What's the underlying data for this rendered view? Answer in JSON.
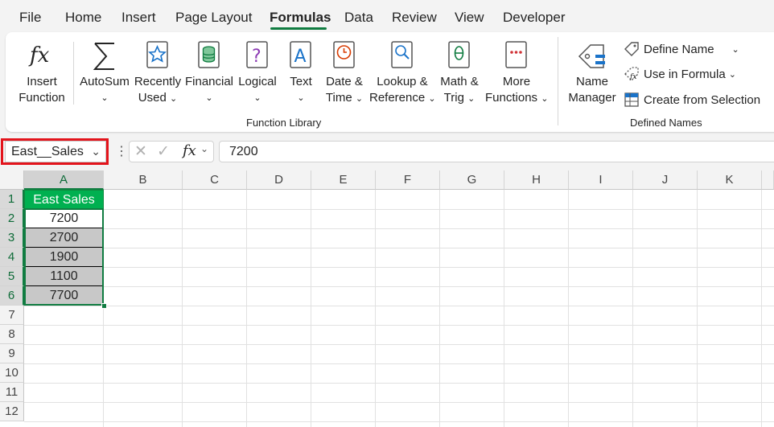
{
  "menu_tabs": [
    "File",
    "Home",
    "Insert",
    "Page Layout",
    "Formulas",
    "Data",
    "Review",
    "View",
    "Developer"
  ],
  "active_tab": "Formulas",
  "ribbon": {
    "insert_function": [
      "Insert",
      "Function"
    ],
    "autosum": "AutoSum",
    "recently_used": [
      "Recently",
      "Used"
    ],
    "financial": "Financial",
    "logical": "Logical",
    "text": "Text",
    "date_time": [
      "Date &",
      "Time"
    ],
    "lookup_reference": [
      "Lookup &",
      "Reference"
    ],
    "math_trig": [
      "Math &",
      "Trig"
    ],
    "more_functions": [
      "More",
      "Functions"
    ],
    "function_library_label": "Function Library",
    "name_manager": [
      "Name",
      "Manager"
    ],
    "define_name": "Define Name",
    "use_in_formula": "Use in Formula",
    "create_from_selection": "Create from Selection",
    "defined_names_label": "Defined Names"
  },
  "formula_bar": {
    "name_box": "East__Sales",
    "fx_label": "fx",
    "formula_value": "7200"
  },
  "sheet": {
    "columns": [
      "A",
      "B",
      "C",
      "D",
      "E",
      "F",
      "G",
      "H",
      "I",
      "J",
      "K"
    ],
    "rows": [
      "1",
      "2",
      "3",
      "4",
      "5",
      "6",
      "7",
      "8",
      "9",
      "10",
      "11",
      "12"
    ],
    "header_cell": "East Sales",
    "values": [
      "7200",
      "2700",
      "1900",
      "1100",
      "7700"
    ]
  },
  "colors": {
    "accent": "#107c41",
    "header_fill": "#00b050",
    "selection_fill": "#c8c8c8",
    "highlight": "#e3141c"
  }
}
